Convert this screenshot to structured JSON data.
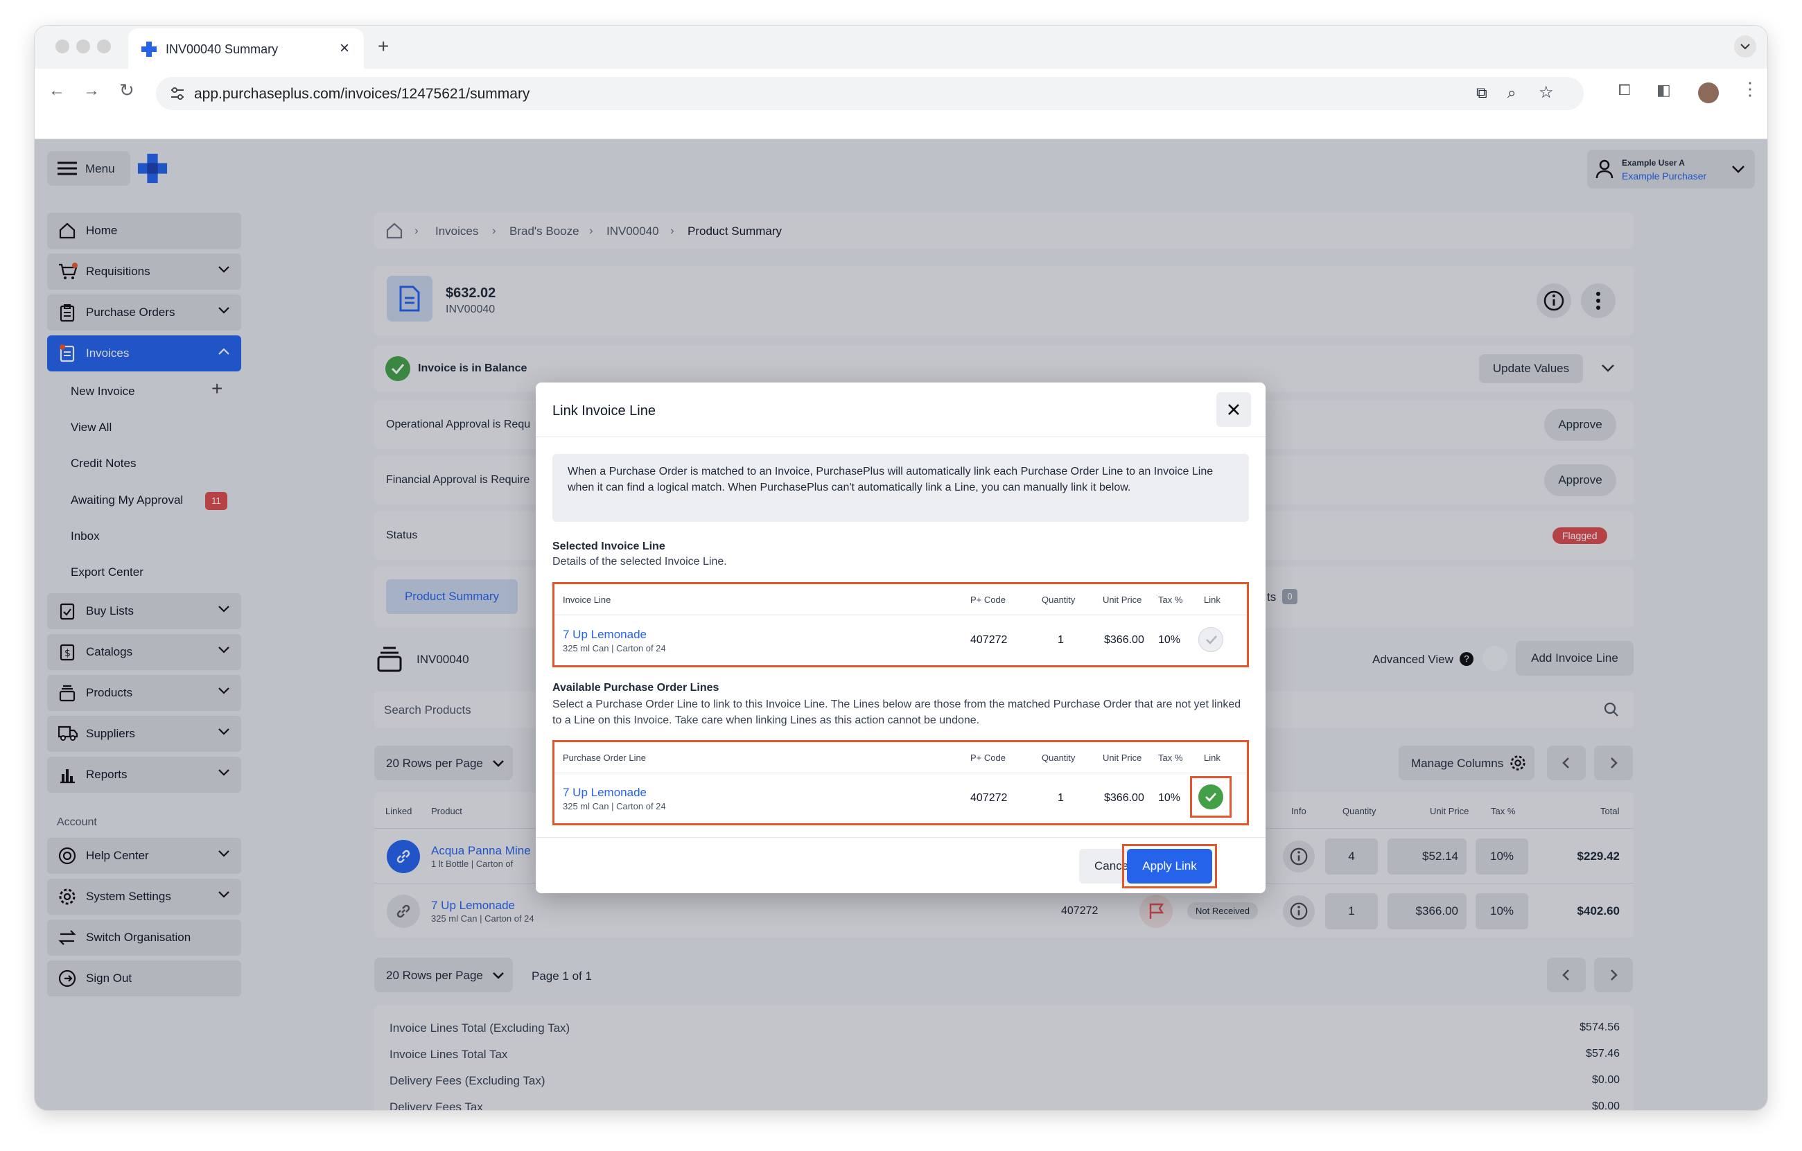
{
  "browser": {
    "tab_title": "INV00040 Summary",
    "url": "app.purchaseplus.com/invoices/12475621/summary"
  },
  "header": {
    "menu_label": "Menu",
    "user_name": "Example User A",
    "user_role": "Example Purchaser"
  },
  "sidebar": {
    "items": [
      {
        "label": "Home"
      },
      {
        "label": "Requisitions"
      },
      {
        "label": "Purchase Orders"
      },
      {
        "label": "Invoices"
      }
    ],
    "invoice_sub": [
      {
        "label": "New Invoice"
      },
      {
        "label": "View All"
      },
      {
        "label": "Credit Notes"
      },
      {
        "label": "Awaiting My Approval",
        "badge": "11"
      },
      {
        "label": "Inbox"
      },
      {
        "label": "Export Center"
      }
    ],
    "items2": [
      {
        "label": "Buy Lists"
      },
      {
        "label": "Catalogs"
      },
      {
        "label": "Products"
      },
      {
        "label": "Suppliers"
      },
      {
        "label": "Reports"
      }
    ],
    "account_heading": "Account",
    "account": [
      {
        "label": "Help Center"
      },
      {
        "label": "System Settings"
      },
      {
        "label": "Switch Organisation"
      },
      {
        "label": "Sign Out"
      }
    ]
  },
  "breadcrumb": [
    "Invoices",
    "Brad's Booze",
    "INV00040",
    "Product Summary"
  ],
  "invoice": {
    "amount": "$632.02",
    "number": "INV00040"
  },
  "balance": {
    "status": "Invoice is in Balance",
    "update_label": "Update Values"
  },
  "approvals": [
    {
      "label": "Operational Approval is Requ",
      "button": "Approve"
    },
    {
      "label": "Financial Approval is Require",
      "button": "Approve"
    }
  ],
  "status_row": {
    "label": "Status",
    "badge": "Flagged"
  },
  "tabs": {
    "active": "Product Summary",
    "count_suffix": "ts",
    "count": "0"
  },
  "lines_section": {
    "title": "INV00040",
    "advanced_view": "Advanced View",
    "add_line": "Add Invoice Line",
    "search_placeholder": "Search Products",
    "rows_per_page": "20 Rows per Page",
    "manage_columns": "Manage Columns",
    "page_info": "Page 1 of 1"
  },
  "table": {
    "headers": {
      "linked": "Linked",
      "product": "Product",
      "info": "Info",
      "quantity": "Quantity",
      "unit_price": "Unit Price",
      "tax": "Tax %",
      "total": "Total"
    },
    "rows": [
      {
        "name": "Acqua Panna Mine",
        "detail": "1 lt Bottle | Carton of",
        "qty": "4",
        "price": "$52.14",
        "tax": "10%",
        "total": "$229.42"
      },
      {
        "name": "7 Up Lemonade",
        "detail": "325 ml Can | Carton of 24",
        "code": "407272",
        "status": "Not Received",
        "qty": "1",
        "price": "$366.00",
        "tax": "10%",
        "total": "$402.60"
      }
    ]
  },
  "totals": [
    {
      "label": "Invoice Lines Total (Excluding Tax)",
      "value": "$574.56"
    },
    {
      "label": "Invoice Lines Total Tax",
      "value": "$57.46"
    },
    {
      "label": "Delivery Fees (Excluding Tax)",
      "value": "$0.00"
    },
    {
      "label": "Delivery Fees Tax",
      "value": "$0.00"
    }
  ],
  "modal": {
    "title": "Link Invoice Line",
    "info": "When a Purchase Order is matched to an Invoice, PurchasePlus will automatically link each Purchase Order Line to an Invoice Line when it can find a logical match. When PurchasePlus can't automatically link a Line, you can manually link it below.",
    "selected_title": "Selected Invoice Line",
    "selected_desc": "Details of the selected Invoice Line.",
    "selected_headers": {
      "line": "Invoice Line",
      "code": "P+ Code",
      "qty": "Quantity",
      "price": "Unit Price",
      "tax": "Tax %",
      "link": "Link"
    },
    "selected_row": {
      "name": "7 Up Lemonade",
      "detail": "325 ml Can | Carton of 24",
      "code": "407272",
      "qty": "1",
      "price": "$366.00",
      "tax": "10%"
    },
    "available_title": "Available Purchase Order Lines",
    "available_desc": "Select a Purchase Order Line to link to this Invoice Line. The Lines below are those from the matched Purchase Order that are not yet linked to a Line on this Invoice. Take care when linking Lines as this action cannot be undone.",
    "available_headers": {
      "line": "Purchase Order Line",
      "code": "P+ Code",
      "qty": "Quantity",
      "price": "Unit Price",
      "tax": "Tax %",
      "link": "Link"
    },
    "available_row": {
      "name": "7 Up Lemonade",
      "detail": "325 ml Can | Carton of 24",
      "code": "407272",
      "qty": "1",
      "price": "$366.00",
      "tax": "10%"
    },
    "cancel": "Cancel",
    "apply": "Apply Link"
  },
  "colors": {
    "accent": "#2563eb",
    "highlight": "#e4572e",
    "success": "#43a047",
    "flag": "#dc4c4c"
  }
}
